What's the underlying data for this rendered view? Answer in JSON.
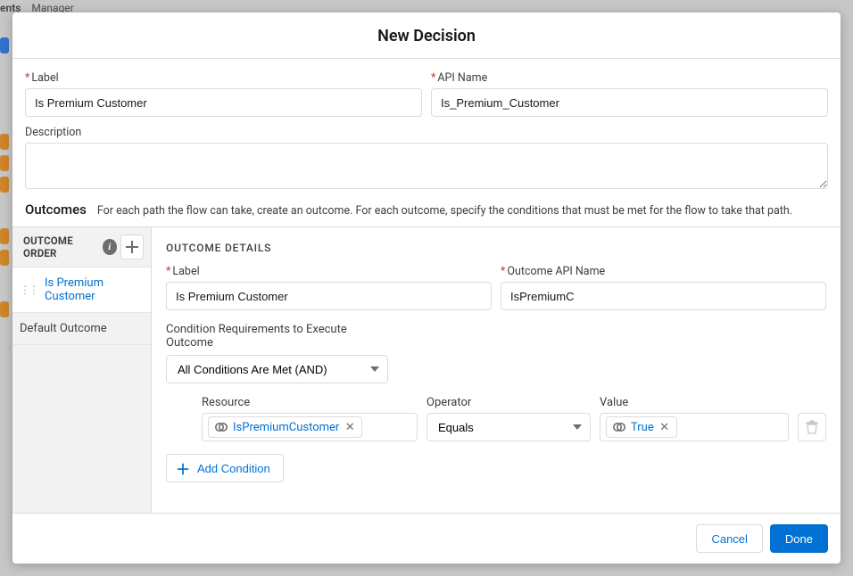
{
  "bg": {
    "tab1": "ents",
    "tab2": "Manager"
  },
  "modal_title": "New Decision",
  "fields": {
    "label_label": "Label",
    "label_value": "Is Premium Customer",
    "api_label": "API Name",
    "api_value": "Is_Premium_Customer",
    "desc_label": "Description",
    "desc_value": ""
  },
  "outcomes": {
    "title": "Outcomes",
    "hint": "For each path the flow can take, create an outcome. For each outcome, specify the conditions that must be met for the flow to take that path.",
    "order_label": "OUTCOME ORDER",
    "items": [
      {
        "label": "Is Premium Customer",
        "active": true
      },
      {
        "label": "Default Outcome",
        "active": false
      }
    ]
  },
  "detail": {
    "section": "OUTCOME DETAILS",
    "label_label": "Label",
    "label_value": "Is Premium Customer",
    "api_label": "Outcome API Name",
    "api_value": "IsPremiumC",
    "cond_req_label": "Condition Requirements to Execute Outcome",
    "cond_req_value": "All Conditions Are Met (AND)",
    "cols": {
      "resource": "Resource",
      "operator": "Operator",
      "value": "Value"
    },
    "condition": {
      "resource": "IsPremiumCustomer",
      "operator": "Equals",
      "value": "True"
    },
    "add_label": "Add Condition"
  },
  "footer": {
    "cancel": "Cancel",
    "done": "Done"
  }
}
